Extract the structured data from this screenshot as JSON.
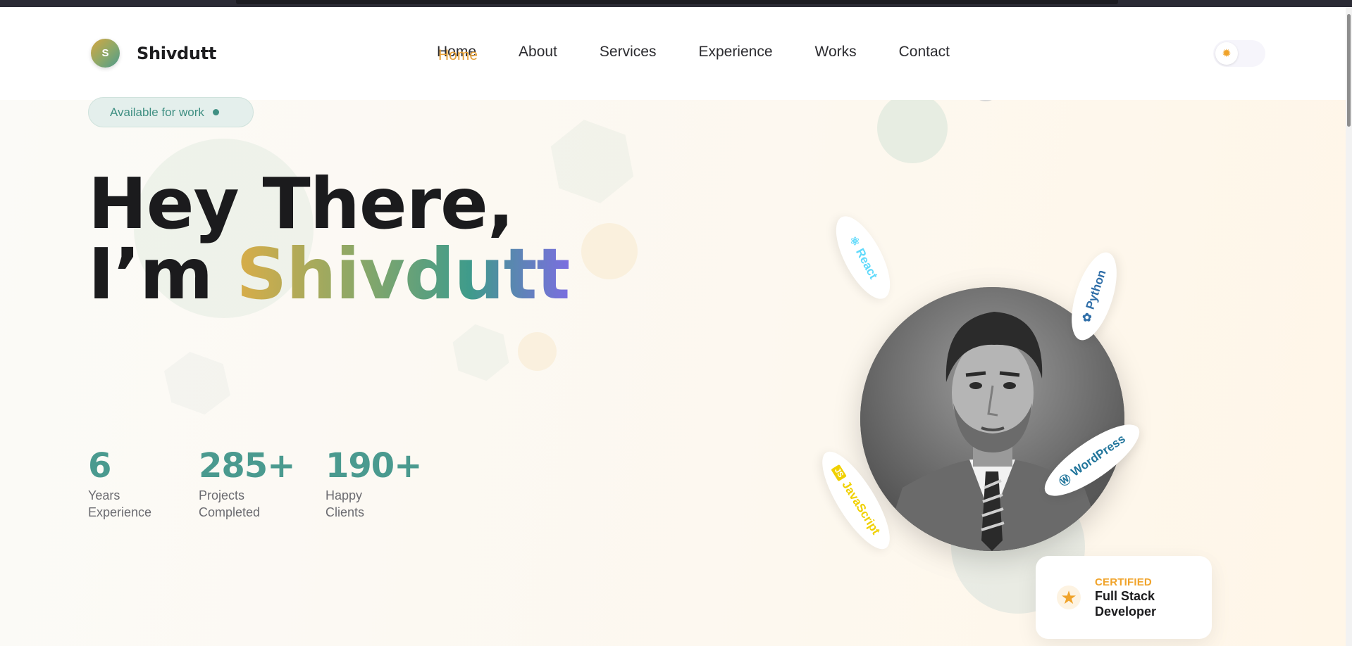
{
  "brand": {
    "initial": "S",
    "name": "Shivdutt"
  },
  "nav": {
    "items": [
      {
        "label": "Home",
        "active": true
      },
      {
        "label": "About"
      },
      {
        "label": "Services"
      },
      {
        "label": "Experience"
      },
      {
        "label": "Works"
      },
      {
        "label": "Contact"
      }
    ]
  },
  "theme_toggle": {
    "icon": "sun-icon",
    "mode": "light"
  },
  "hero": {
    "badge": "Available for work",
    "headline_line1": "Hey There,",
    "headline_prefix": "I’m",
    "headline_name": "Shivdutt",
    "stats": [
      {
        "value": "6",
        "label_line1": "Years",
        "label_line2": "Experience"
      },
      {
        "value": "285+",
        "label_line1": "Projects",
        "label_line2": "Completed"
      },
      {
        "value": "190+",
        "label_line1": "Happy",
        "label_line2": "Clients"
      }
    ],
    "skills": [
      {
        "label": "React",
        "icon": "react-icon",
        "color": "#61dafb"
      },
      {
        "label": "Python",
        "icon": "python-icon",
        "color": "#2f6ea8"
      },
      {
        "label": "WordPress",
        "icon": "wordpress-icon",
        "color": "#21759b"
      },
      {
        "label": "JavaScript",
        "icon": "javascript-icon",
        "color": "#f0d000"
      }
    ],
    "certified_card": {
      "kicker": "CERTIFIED",
      "line1": "Full Stack",
      "line2": "Developer",
      "icon": "star-icon"
    }
  },
  "colors": {
    "accent_teal": "#4a9a8f",
    "accent_orange": "#f0a32a",
    "text_dark": "#1b1b1d"
  }
}
